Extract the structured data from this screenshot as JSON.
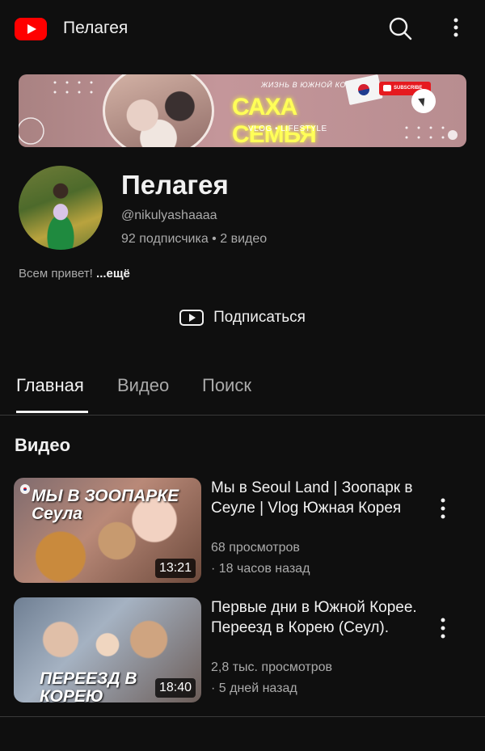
{
  "topbar": {
    "title": "Пелагея",
    "icons": [
      "youtube-logo",
      "search-icon",
      "more-icon"
    ]
  },
  "banner": {
    "top_text": "ЖИЗНЬ В ЮЖНОЙ КОРЕЕ",
    "title": "САХА СЕМЬЯ",
    "subtitle": "VLOG   •   LIFESTYLE",
    "subscribe_label": "SUBSCRIBE"
  },
  "channel": {
    "name": "Пелагея",
    "handle": "@nikulyashaaaa",
    "stats": "92 подписчика • 2 видео",
    "description": "Всем привет! ",
    "description_more": "...ещё",
    "subscribe_label": "Подписаться"
  },
  "tabs": [
    "Главная",
    "Видео",
    "Поиск"
  ],
  "section_title": "Видео",
  "videos": [
    {
      "thumb_text": "МЫ В ЗООПАРКЕ Сеула",
      "duration": "13:21",
      "title": "Мы в Seoul Land | Зоопарк в Сеуле | Vlog Южная Корея",
      "views": "68 просмотров",
      "date": "· 18 часов назад"
    },
    {
      "thumb_text": "ПЕРЕЕЗД В КОРЕЮ",
      "duration": "18:40",
      "title": "Первые дни в Южной Корее. Переезд в Корею (Сеул).",
      "views": "2,8 тыс. просмотров",
      "date": "· 5 дней назад"
    }
  ],
  "colors": {
    "background": "#0f0f0f",
    "primary_text": "#f1f1f1",
    "secondary_text": "#aaaaaa",
    "youtube_red": "#ff0000",
    "banner_yellow": "#ffff58"
  }
}
